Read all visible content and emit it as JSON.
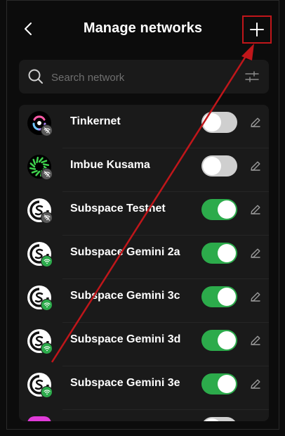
{
  "header": {
    "title": "Manage networks",
    "back_icon": "chevron-left-icon",
    "add_icon": "plus-icon"
  },
  "search": {
    "placeholder": "Search network",
    "icon": "search-icon",
    "filter_icon": "sliders-icon"
  },
  "colors": {
    "background": "#0c0c0c",
    "card": "#1a1a1a",
    "toggle_on": "#2cab4b",
    "toggle_off": "#cfcfcf",
    "highlight": "#c0161a"
  },
  "networks": [
    {
      "name": "Tinkernet",
      "enabled": false,
      "connection": "disconnected",
      "logo": "tinkernet-logo"
    },
    {
      "name": "Imbue Kusama",
      "enabled": false,
      "connection": "disconnected",
      "logo": "imbue-logo"
    },
    {
      "name": "Subspace Testnet",
      "enabled": true,
      "connection": "disconnected",
      "logo": "subspace-logo"
    },
    {
      "name": "Subspace Gemini 2a",
      "enabled": true,
      "connection": "connected",
      "logo": "subspace-logo"
    },
    {
      "name": "Subspace Gemini 3c",
      "enabled": true,
      "connection": "connected",
      "logo": "subspace-logo"
    },
    {
      "name": "Subspace Gemini 3d",
      "enabled": true,
      "connection": "connected",
      "logo": "subspace-logo"
    },
    {
      "name": "Subspace Gemini 3e",
      "enabled": true,
      "connection": "connected",
      "logo": "subspace-logo"
    }
  ]
}
